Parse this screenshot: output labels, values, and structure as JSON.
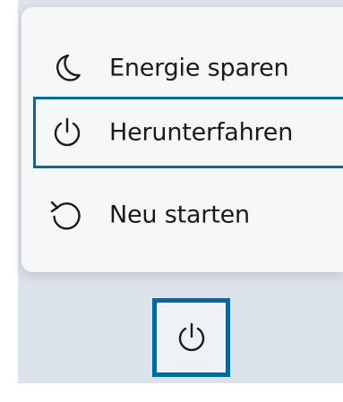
{
  "power_menu": {
    "items": [
      {
        "label": "Energie sparen",
        "icon": "moon-icon"
      },
      {
        "label": "Herunterfahren",
        "icon": "power-icon"
      },
      {
        "label": "Neu starten",
        "icon": "restart-icon"
      }
    ],
    "selected_index": 1
  },
  "power_button": {
    "icon": "power-icon"
  },
  "colors": {
    "accent": "#0069a6",
    "menu_background": "#f6f7f9",
    "backdrop": "#dde3ea",
    "text": "#1a1a1a"
  }
}
